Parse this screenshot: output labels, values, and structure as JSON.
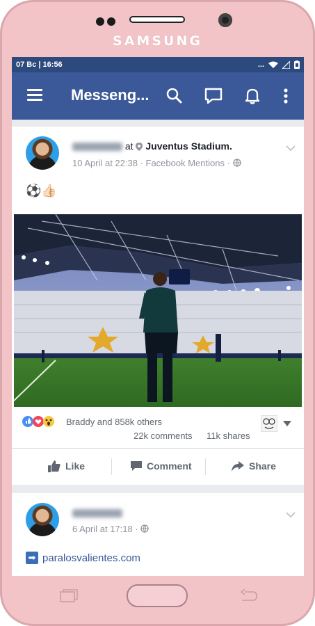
{
  "device": {
    "brand": "SAMSUNG"
  },
  "status_bar": {
    "left": "07 Bc  |  16:56",
    "right_text": "..."
  },
  "appbar": {
    "title": "Messeng..."
  },
  "posts": [
    {
      "author_text": "at",
      "location": "Juventus Stadium.",
      "meta": "10 April at 22:38 · Facebook Mentions ·",
      "body": "⚽👍🏻",
      "reactions_text": "Braddy and 858k others",
      "comments": "22k comments",
      "shares": "11k shares"
    },
    {
      "meta": "6 April at 17:18 ·",
      "link_arrow": "➡",
      "link_text": "paralosvalientes.com"
    }
  ],
  "actions": {
    "like": "Like",
    "comment": "Comment",
    "share": "Share"
  },
  "icons": [
    "hamburger-icon",
    "search-icon",
    "chat-bubble-icon",
    "bell-icon",
    "more-vert-icon",
    "location-pin-icon",
    "globe-icon",
    "chevron-down-icon",
    "like-thumb-icon",
    "comment-icon",
    "share-arrow-icon",
    "recent-apps-icon",
    "back-icon"
  ],
  "colors": {
    "facebook_blue": "#3b5998",
    "status_bar": "#2d4a7e",
    "phone_body": "#f2c4c8",
    "link_blue": "#385898"
  }
}
